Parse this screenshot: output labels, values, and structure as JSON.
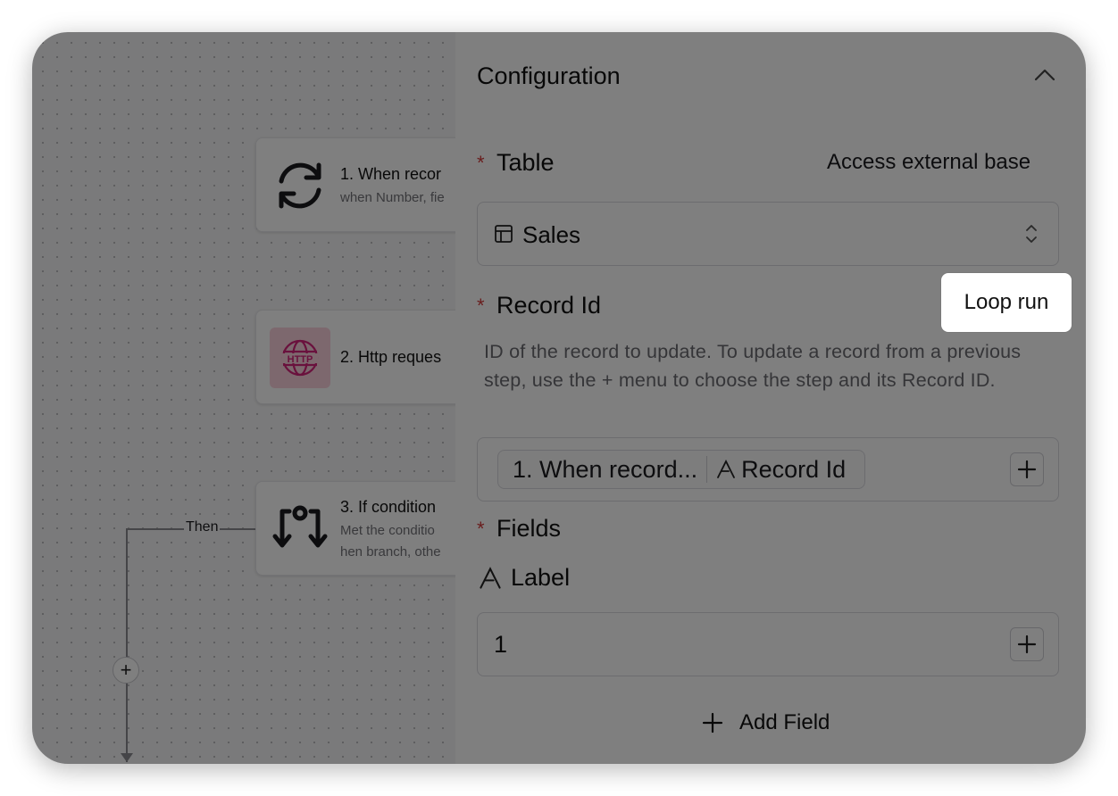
{
  "canvas": {
    "nodes": [
      {
        "title": "1. When recor",
        "subtitle": "when Number, fie",
        "icon": "refresh-icon"
      },
      {
        "title": "2. Http reques",
        "subtitle": "",
        "icon": "http-globe-icon",
        "badge_text": "HTTP"
      },
      {
        "title": "3. If condition",
        "subtitle": "Met the conditio",
        "subtitle2": "hen branch, othe",
        "icon": "if-branch-icon"
      }
    ],
    "branch_label": "Then",
    "add_step_symbol": "+"
  },
  "panel": {
    "title": "Configuration",
    "collapse_icon": "chevron-up-icon",
    "table": {
      "label": "Table",
      "required_mark": "*",
      "external_link": "Access external base",
      "selected": "Sales",
      "icon": "table-icon"
    },
    "record_id": {
      "label": "Record Id",
      "required_mark": "*",
      "loop_button": "Loop run",
      "help_text": "ID of the record to update. To update a record from a previous step, use the + menu to choose the step and its Record ID.",
      "token_step": "1. When record...",
      "token_field": "Record Id",
      "token_field_icon": "text-field-icon"
    },
    "fields": {
      "label": "Fields",
      "required_mark": "*",
      "items": [
        {
          "label": "Label",
          "icon": "text-field-icon",
          "value": "1"
        }
      ],
      "add_label": "Add Field"
    }
  }
}
